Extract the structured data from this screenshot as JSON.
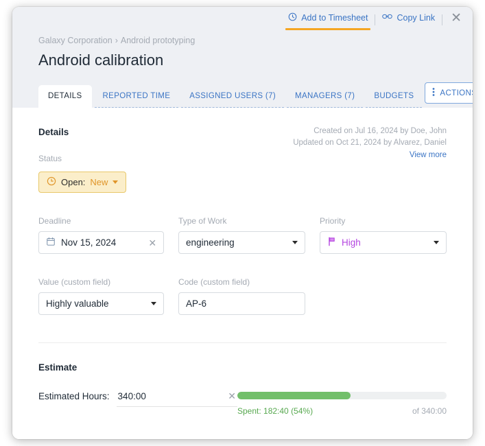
{
  "topbar": {
    "add_to_timesheet": "Add to Timesheet",
    "copy_link": "Copy Link",
    "close_label": "✕",
    "clock_icon": "clock-icon",
    "link_icon": "link-icon",
    "accent_underline_color": "#f5a623"
  },
  "header": {
    "breadcrumb": {
      "root": "Galaxy Corporation",
      "separator": "›",
      "parent": "Android prototyping"
    },
    "title": "Android calibration"
  },
  "tabs": [
    {
      "label": "DETAILS",
      "active": true
    },
    {
      "label": "REPORTED TIME",
      "active": false
    },
    {
      "label": "ASSIGNED USERS (7)",
      "active": false
    },
    {
      "label": "MANAGERS (7)",
      "active": false
    },
    {
      "label": "BUDGETS",
      "active": false
    }
  ],
  "actions_button": {
    "label": "ACTIONS",
    "menu_icon": "vertical-dots-icon"
  },
  "details": {
    "section_title": "Details",
    "created": "Created on Jul 16, 2024 by Doe, John",
    "updated": "Updated on Oct 21, 2024 by Alvarez, Daniel",
    "view_more": "View more",
    "status": {
      "label": "Status",
      "prefix": "Open:",
      "value": "New",
      "icon": "clock-icon",
      "bg": "#fbeeca",
      "border": "#e8c86a",
      "value_color": "#e0952a"
    },
    "fields": {
      "deadline": {
        "label": "Deadline",
        "value": "Nov 15, 2024",
        "icon": "calendar-icon",
        "clear": "✕"
      },
      "type_of_work": {
        "label": "Type of Work",
        "value": "engineering"
      },
      "priority": {
        "label": "Priority",
        "value": "High",
        "icon": "flag-icon",
        "color": "#b446e0"
      },
      "value_custom": {
        "label": "Value (custom field)",
        "value": "Highly valuable"
      },
      "code_custom": {
        "label": "Code (custom field)",
        "value": "AP-6"
      }
    }
  },
  "estimate": {
    "section_title": "Estimate",
    "hours_label": "Estimated Hours:",
    "hours_value": "340:00",
    "clear": "✕",
    "spent_text": "Spent: 182:40 (54%)",
    "total_text": "of 340:00",
    "percent": 54,
    "fill_color": "#72bf6a",
    "track_color": "#eef0f1"
  }
}
